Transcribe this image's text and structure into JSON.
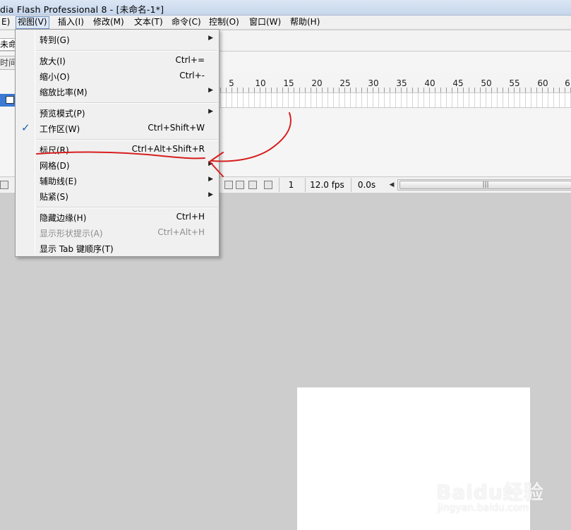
{
  "window": {
    "title": "dia Flash Professional 8 - [未命名-1*]"
  },
  "menubar": {
    "items": [
      {
        "label": "E)"
      },
      {
        "label": "视图(V)",
        "active": true
      },
      {
        "label": "插入(I)"
      },
      {
        "label": "修改(M)"
      },
      {
        "label": "文本(T)"
      },
      {
        "label": "命令(C)"
      },
      {
        "label": "控制(O)"
      },
      {
        "label": "窗口(W)"
      },
      {
        "label": "帮助(H)"
      }
    ]
  },
  "document": {
    "tab_label": "未命"
  },
  "timeline": {
    "tab_label": "时间",
    "ruler_labels": [
      "5",
      "10",
      "15",
      "20",
      "25",
      "30",
      "35",
      "40",
      "45",
      "50",
      "55",
      "60",
      "6"
    ],
    "status": {
      "current_frame": "1",
      "frame_rate": "12.0 fps",
      "elapsed_time": "0.0s"
    }
  },
  "view_menu": {
    "items": [
      {
        "label": "转到(G)",
        "shortcut": "",
        "submenu": true
      },
      {
        "label": "放大(I)",
        "shortcut": "Ctrl+="
      },
      {
        "label": "缩小(O)",
        "shortcut": "Ctrl+-"
      },
      {
        "label": "缩放比率(M)",
        "shortcut": "",
        "submenu": true
      },
      {
        "label": "预览模式(P)",
        "shortcut": "",
        "submenu": true
      },
      {
        "label": "工作区(W)",
        "shortcut": "Ctrl+Shift+W",
        "checked": true
      },
      {
        "label": "标尺(R)",
        "shortcut": "Ctrl+Alt+Shift+R"
      },
      {
        "label": "网格(D)",
        "shortcut": "",
        "submenu": true
      },
      {
        "label": "辅助线(E)",
        "shortcut": "",
        "submenu": true
      },
      {
        "label": "贴紧(S)",
        "shortcut": "",
        "submenu": true
      },
      {
        "label": "隐藏边缘(H)",
        "shortcut": "Ctrl+H"
      },
      {
        "label": "显示形状提示(A)",
        "shortcut": "Ctrl+Alt+H",
        "disabled": true
      },
      {
        "label": "显示 Tab 键顺序(T)",
        "shortcut": ""
      }
    ]
  },
  "watermark": {
    "brand": "Baidu经验",
    "site": "jingyan.baidu.com"
  },
  "colors": {
    "annotation": "#d81e1e",
    "selection_row": "#3b79d4",
    "check": "#1e5fb0",
    "workspace": "#cdcdcd"
  }
}
